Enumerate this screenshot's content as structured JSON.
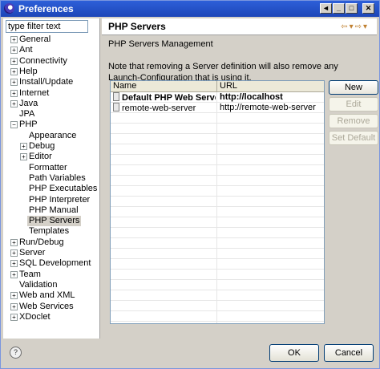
{
  "window": {
    "title": "Preferences"
  },
  "title_buttons": {
    "back": "◄",
    "minimize": "_",
    "maximize": "□",
    "close": "✕"
  },
  "filter": {
    "placeholder": "type filter text",
    "value": "type filter text"
  },
  "tree": [
    {
      "label": "General",
      "expander": "+"
    },
    {
      "label": "Ant",
      "expander": "+"
    },
    {
      "label": "Connectivity",
      "expander": "+"
    },
    {
      "label": "Help",
      "expander": "+"
    },
    {
      "label": "Install/Update",
      "expander": "+"
    },
    {
      "label": "Internet",
      "expander": "+"
    },
    {
      "label": "Java",
      "expander": "+"
    },
    {
      "label": "JPA",
      "expander": ""
    },
    {
      "label": "PHP",
      "expander": "−"
    },
    {
      "label": "Appearance",
      "expander": ""
    },
    {
      "label": "Debug",
      "expander": "+"
    },
    {
      "label": "Editor",
      "expander": "+"
    },
    {
      "label": "Formatter",
      "expander": ""
    },
    {
      "label": "Path Variables",
      "expander": ""
    },
    {
      "label": "PHP Executables",
      "expander": ""
    },
    {
      "label": "PHP Interpreter",
      "expander": ""
    },
    {
      "label": "PHP Manual",
      "expander": ""
    },
    {
      "label": "PHP Servers",
      "expander": "",
      "selected": true
    },
    {
      "label": "Templates",
      "expander": ""
    },
    {
      "label": "Run/Debug",
      "expander": "+"
    },
    {
      "label": "Server",
      "expander": "+"
    },
    {
      "label": "SQL Development",
      "expander": "+"
    },
    {
      "label": "Team",
      "expander": "+"
    },
    {
      "label": "Validation",
      "expander": ""
    },
    {
      "label": "Web and XML",
      "expander": "+"
    },
    {
      "label": "Web Services",
      "expander": "+"
    },
    {
      "label": "XDoclet",
      "expander": "+"
    }
  ],
  "page": {
    "title": "PHP Servers",
    "nav_icons": "⇦▾⇨▾",
    "section": "PHP Servers Management",
    "note": "Note that removing a Server definition will also remove any Launch-Configuration that is using it."
  },
  "table": {
    "columns": [
      "Name",
      "URL"
    ],
    "rows": [
      {
        "name": "Default PHP Web Server(...",
        "url": "http://localhost",
        "bold": true
      },
      {
        "name": "remote-web-server",
        "url": "http://remote-web-server",
        "bold": false
      }
    ]
  },
  "buttons": {
    "new": "New",
    "edit": "Edit",
    "remove": "Remove",
    "set_default": "Set Default"
  },
  "footer": {
    "help": "?",
    "ok": "OK",
    "cancel": "Cancel"
  }
}
